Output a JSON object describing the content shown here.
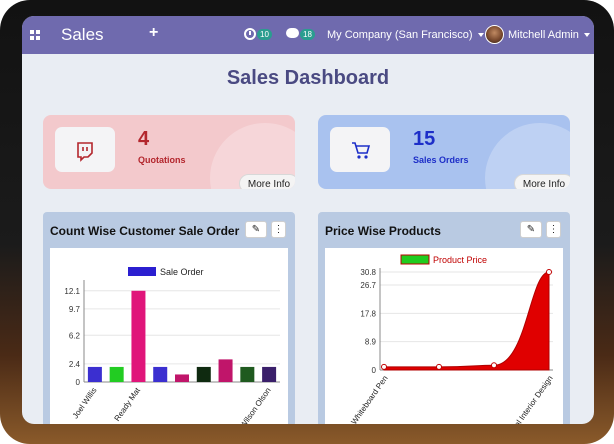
{
  "navbar": {
    "app_title": "Sales",
    "plus_icon": "+",
    "activity_count": "10",
    "messages_count": "18",
    "company": "My Company (San Francisco)",
    "user": "Mitchell Admin"
  },
  "page_title": "Sales Dashboard",
  "cards": [
    {
      "count": "4",
      "label": "Quotations",
      "icon": "twitch-icon",
      "more": "More Info",
      "color": "#b3262d"
    },
    {
      "count": "15",
      "label": "Sales Orders",
      "icon": "cart-icon",
      "more": "More Info",
      "color": "#1d2ec8"
    }
  ],
  "panels": {
    "left_title": "Count Wise Customer Sale Order",
    "right_title": "Price Wise Products",
    "brush_icon": "✎",
    "more_icon": "⋮"
  },
  "chart_data": [
    {
      "type": "bar",
      "legend": "Sale Order",
      "legend_color": "#2b1fd0",
      "y_ticks": [
        "0",
        "2.4",
        "6.2",
        "9.7",
        "12.1"
      ],
      "ylim": [
        0,
        13
      ],
      "categories": [
        "Joel Willis",
        "",
        "Ready Mat",
        "",
        "",
        "",
        "",
        "",
        "Wilson Olson"
      ],
      "category_labels_visible": [
        "Joel Willis",
        "Ready Mat",
        "Wilson Olson"
      ],
      "values": [
        2,
        2,
        12.1,
        2,
        1,
        2,
        3,
        2,
        2
      ],
      "colors": [
        "#3b2fd0",
        "#22cc22",
        "#e0157a",
        "#3b2fd0",
        "#c0156a",
        "#0f2a10",
        "#c0156a",
        "#1f5a1f",
        "#3a1f6a"
      ]
    },
    {
      "type": "area",
      "legend": "Product Price",
      "legend_color": "#1fcc1f",
      "series_color": "#e00000",
      "y_ticks": [
        "0",
        "8.9",
        "17.8",
        "26.7",
        "30.8"
      ],
      "ylim": [
        0,
        30.8
      ],
      "categories": [
        "Whiteboard Pen",
        "",
        "",
        "Virtual Interior Design"
      ],
      "values": [
        1,
        1,
        1.5,
        30.8
      ]
    }
  ]
}
